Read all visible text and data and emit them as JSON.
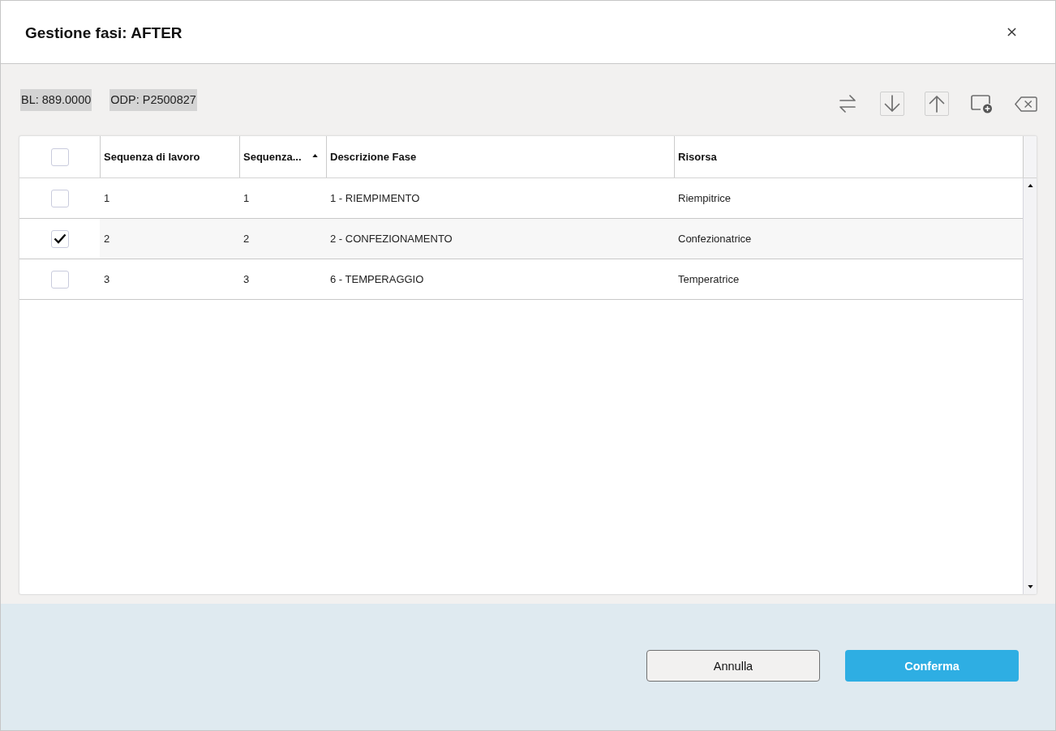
{
  "dialog": {
    "title": "Gestione fasi: AFTER"
  },
  "info_chips": [
    "BL: 889.0000",
    "ODP: P2500827"
  ],
  "toolbar": [
    {
      "kind": "swap"
    },
    {
      "kind": "move-down"
    },
    {
      "kind": "move-up"
    },
    {
      "kind": "add-window"
    },
    {
      "kind": "delete"
    }
  ],
  "table": {
    "select_all": {
      "checked": false
    },
    "columns": [
      {
        "label": "Sequenza di lavoro",
        "sorted": false
      },
      {
        "label": "Sequenza...",
        "sorted": true
      },
      {
        "label": "Descrizione Fase",
        "sorted": false
      },
      {
        "label": "Risorsa",
        "sorted": false
      }
    ],
    "rows": [
      {
        "checked": false,
        "cells": [
          "1",
          "1",
          "1 - RIEMPIMENTO",
          "Riempitrice"
        ]
      },
      {
        "checked": true,
        "cells": [
          "2",
          "2",
          "2 - CONFEZIONAMENTO",
          "Confezionatrice"
        ]
      },
      {
        "checked": false,
        "cells": [
          "3",
          "3",
          "6 - TEMPERAGGIO",
          "Temperatrice"
        ]
      }
    ]
  },
  "buttons": [
    {
      "label": "Annulla",
      "kind": "secondary"
    },
    {
      "label": "Conferma",
      "kind": "primary"
    }
  ]
}
